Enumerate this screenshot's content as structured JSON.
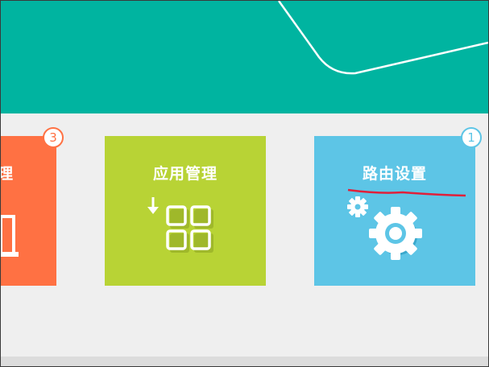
{
  "header": {
    "background_color": "#00b4a0",
    "decoration": "curved-line-decoration"
  },
  "tiles": [
    {
      "title": "理",
      "color": "#ff7143",
      "badge": "3",
      "icon": "device-icon"
    },
    {
      "title": "应用管理",
      "color": "#b8d335",
      "icon": "app-grid-download-icon"
    },
    {
      "title": "路由设置",
      "color": "#5dc5e6",
      "badge": "1",
      "icon": "gear-icon"
    }
  ],
  "annotation": {
    "color": "#e0203a",
    "type": "red-underline-mark"
  }
}
